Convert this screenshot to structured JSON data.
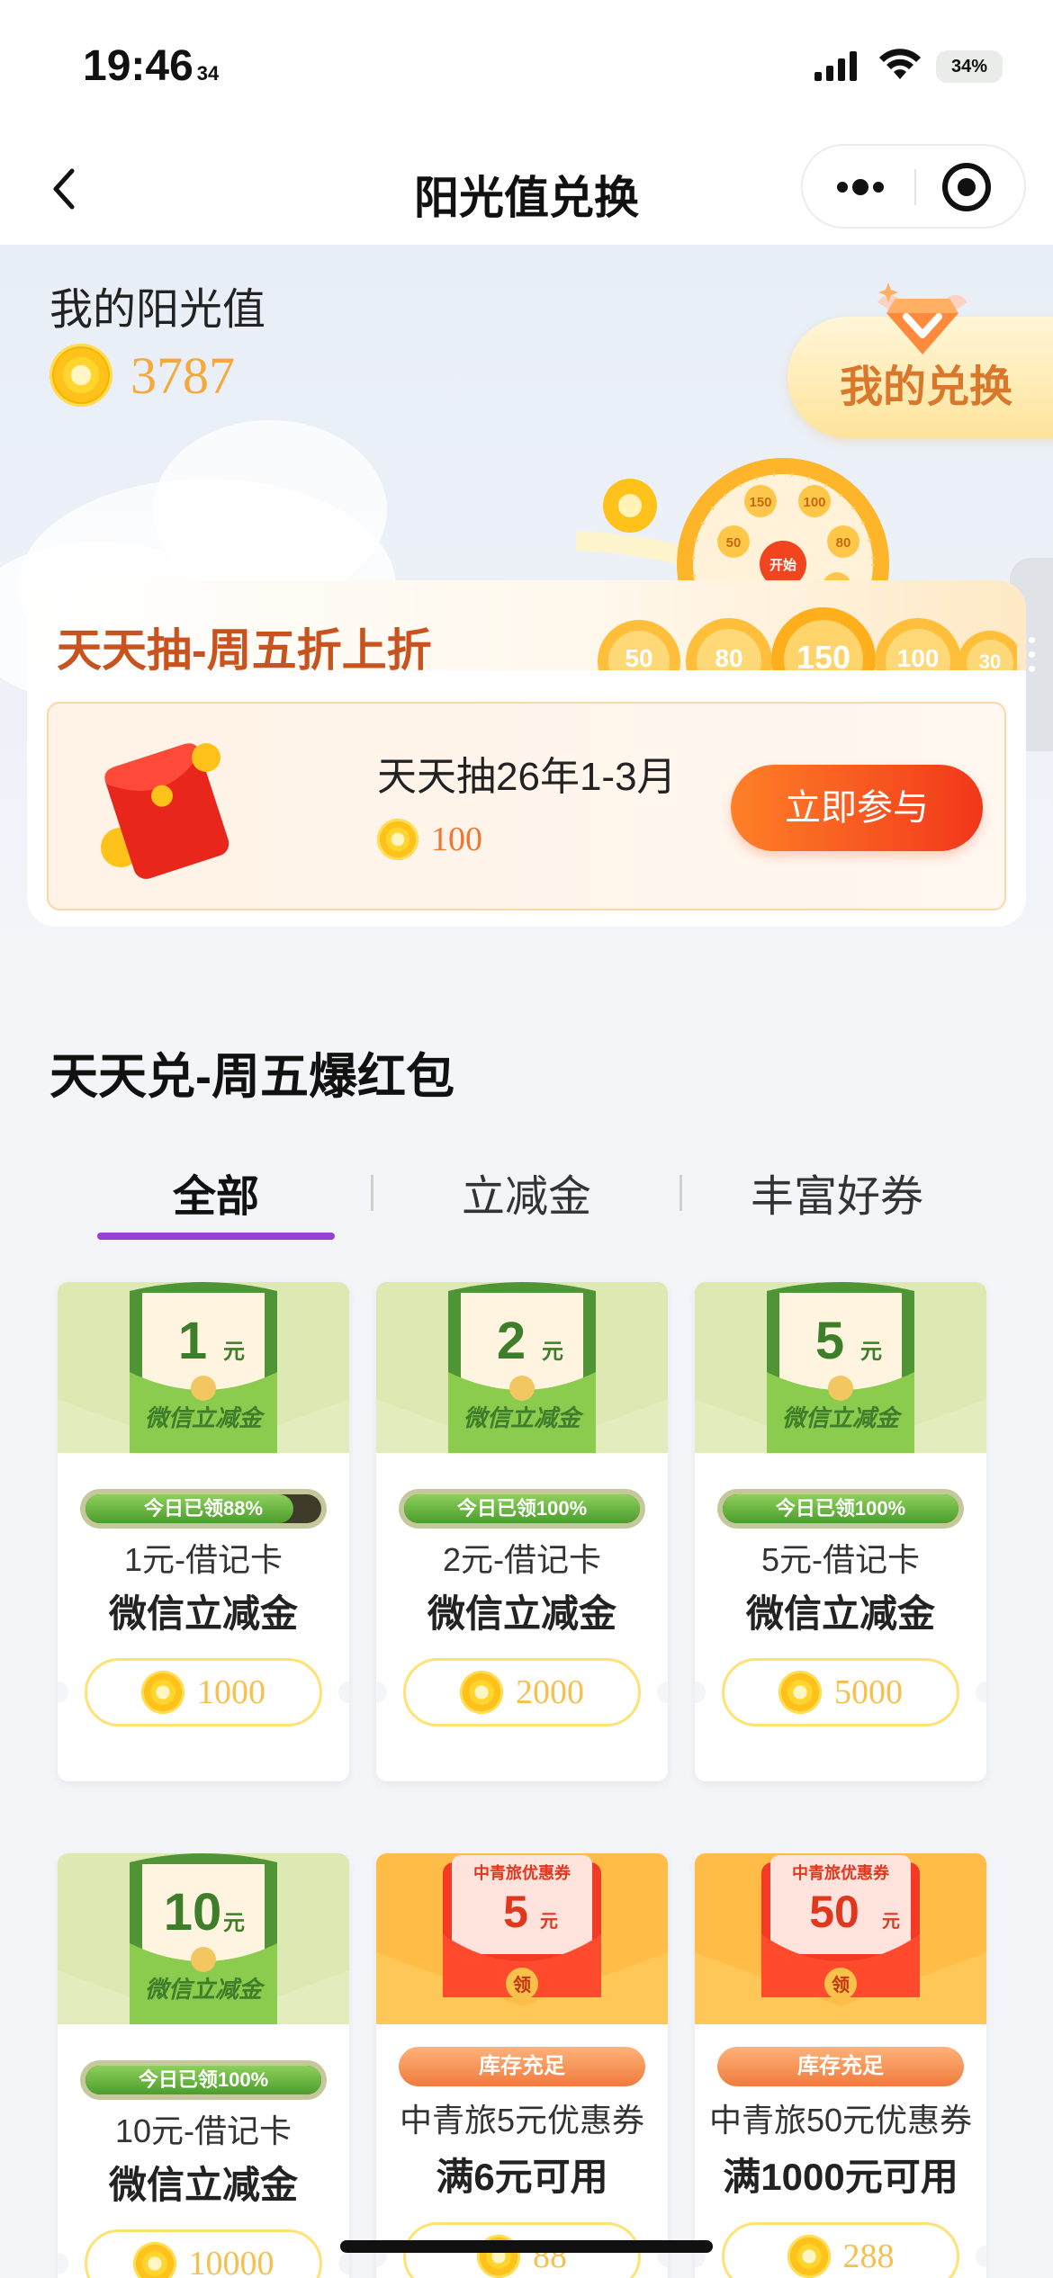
{
  "status_bar": {
    "time": "19:46",
    "seconds": "34",
    "battery": "34%"
  },
  "nav": {
    "title": "阳光值兑换"
  },
  "balance": {
    "label": "我的阳光值",
    "value": "3787"
  },
  "my_exchange_label": "我的兑换",
  "lottery": {
    "title": "天天抽-周五折上折",
    "item_name": "天天抽26年1-3月",
    "cost": "100",
    "button": "立即参与",
    "wheel_labels": [
      "150",
      "100",
      "80",
      "50",
      "30",
      "开始"
    ]
  },
  "section": {
    "title": "天天兑-周五爆红包",
    "tabs": [
      "全部",
      "立减金",
      "丰富好券"
    ],
    "active_tab": 0
  },
  "products": [
    {
      "type": "wechat",
      "amount": "1",
      "unit": "元",
      "tag": "微信立减金",
      "progress_text": "今日已领88%",
      "progress": 0.88,
      "sub": "1元-借记卡",
      "main": "微信立减金",
      "price": "1000"
    },
    {
      "type": "wechat",
      "amount": "2",
      "unit": "元",
      "tag": "微信立减金",
      "progress_text": "今日已领100%",
      "progress": 1.0,
      "sub": "2元-借记卡",
      "main": "微信立减金",
      "price": "2000"
    },
    {
      "type": "wechat",
      "amount": "5",
      "unit": "元",
      "tag": "微信立减金",
      "progress_text": "今日已领100%",
      "progress": 1.0,
      "sub": "5元-借记卡",
      "main": "微信立减金",
      "price": "5000"
    },
    {
      "type": "wechat",
      "amount": "10",
      "unit": "元",
      "tag": "微信立减金",
      "progress_text": "今日已领100%",
      "progress": 1.0,
      "sub": "10元-借记卡",
      "main": "微信立减金",
      "price": "10000"
    },
    {
      "type": "coupon",
      "amount": "5",
      "unit": "元",
      "tag": "中青旅优惠券",
      "badge": "领",
      "stock_text": "库存充足",
      "sub": "中青旅5元优惠券",
      "main": "满6元可用",
      "price": "88"
    },
    {
      "type": "coupon",
      "amount": "50",
      "unit": "元",
      "tag": "中青旅优惠券",
      "badge": "领",
      "stock_text": "库存充足",
      "sub": "中青旅50元优惠券",
      "main": "满1000元可用",
      "price": "288"
    }
  ],
  "colors": {
    "accent": "#9b3fd0",
    "orange": "#f2371a",
    "coin": "#ffc21a",
    "green": "#4c9d2d"
  }
}
